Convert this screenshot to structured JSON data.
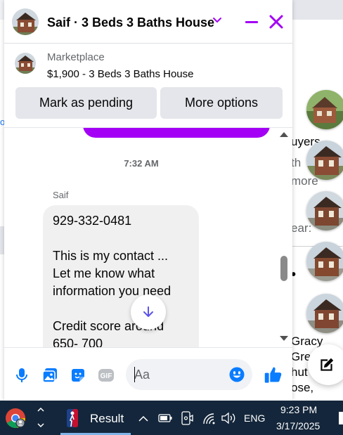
{
  "chat": {
    "title": "Saif · 3 Beds 3 Baths House",
    "listing": {
      "source": "Marketplace",
      "price_title": "$1,900 - 3 Beds 3 Baths House",
      "buttons": [
        "Mark as pending",
        "More options"
      ]
    },
    "timestamp": "7:32 AM",
    "sender": "Saif",
    "message": "929-332-0481\n\nThis is my contact ...\nLet me know what information you need\n\nCredit score around\n650- 700",
    "composer": {
      "placeholder": "Aa"
    }
  },
  "background": {
    "left_mark": "o",
    "texts": [
      "uyers",
      "th",
      "more",
      "ear:",
      "Gracy",
      "Grea",
      "hut",
      "ose,"
    ]
  },
  "taskbar": {
    "app_label": "Result",
    "language": "ENG",
    "time": "9:23 PM",
    "date": "3/17/2025"
  },
  "colors": {
    "accent": "#a300f5",
    "messenger_blue": "#0a7cff",
    "taskbar": "#14263b"
  },
  "icons": [
    "chevron-down-icon",
    "minimize-icon",
    "close-icon",
    "arrow-down-icon",
    "microphone-icon",
    "image-icon",
    "sticker-icon",
    "gif-icon",
    "emoji-icon",
    "thumbs-up-icon",
    "compose-icon",
    "chrome-icon",
    "nba-icon",
    "wifi-icon",
    "volume-icon",
    "battery-icon"
  ]
}
